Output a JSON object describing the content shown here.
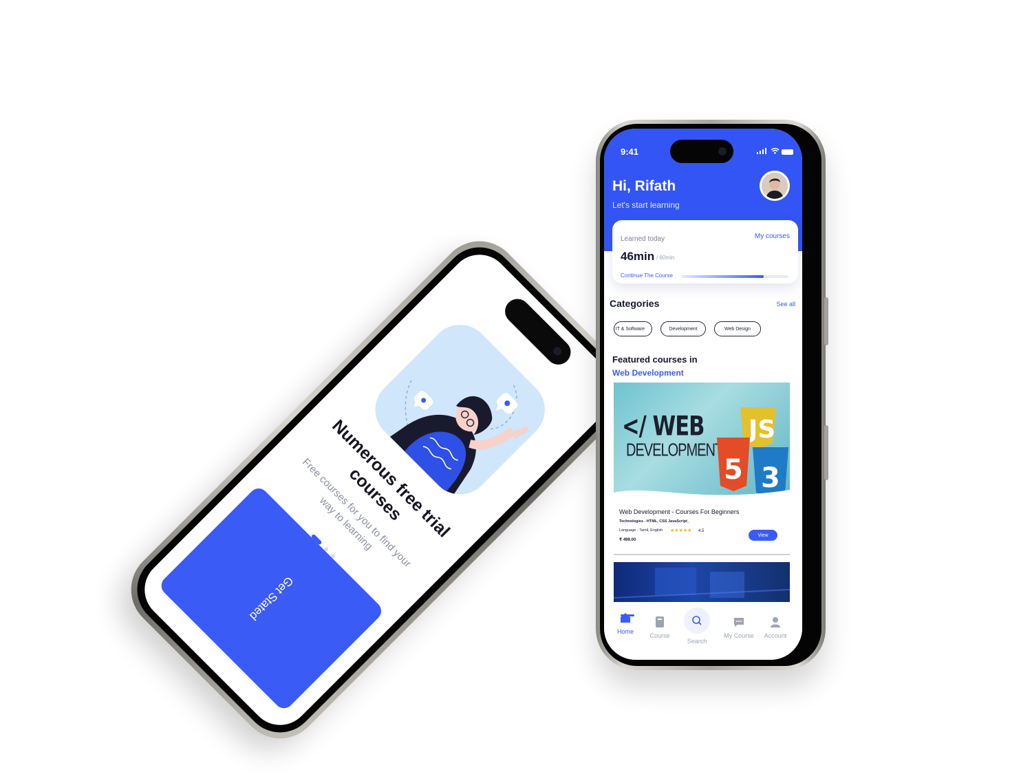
{
  "onboarding": {
    "title": "Numerous free trial courses",
    "subtitle": "Free courses for you to find your way to learning",
    "button_label": "Get Stated",
    "page_count": 3,
    "active_page": 1
  },
  "status_bar": {
    "time": "9:41"
  },
  "header": {
    "greeting": "Hi, Rifath",
    "subtitle": "Let's start learning"
  },
  "learned_today": {
    "label": "Learned today",
    "link": "My courses",
    "value": "46min",
    "of_total": "/ 60min",
    "continue_label": "Continue The Course",
    "progress": 0.77
  },
  "categories": {
    "title": "Categories",
    "see_all": "See all",
    "chips": [
      "IT & Software",
      "Development",
      "Web Design"
    ]
  },
  "featured": {
    "title": "Featured courses in",
    "subtitle": "Web Development"
  },
  "banner": {
    "line1": "</ WEB",
    "line2": "DEVELOPMENT>"
  },
  "course": {
    "title": "Web Development - Courses For Beginners",
    "technologies": "Technologies - HTML, CSS JavaScript_",
    "language": "Language - Tamil, English",
    "stars": "★★★★★",
    "rating": "4.5",
    "price": "₹ 499.00",
    "view_label": "View"
  },
  "tabs": {
    "home": "Home",
    "course": "Course",
    "search": "Search",
    "my_course": "My Course",
    "account": "Account"
  },
  "colors": {
    "accent": "#3b5bf6",
    "header": "#3355f5",
    "illustration_bg": "#cfe6fb",
    "star": "#f5b301"
  },
  "icons": [
    "home-icon",
    "book-icon",
    "search-icon",
    "chat-icon",
    "user-icon",
    "battery-icon",
    "wifi-icon",
    "signal-icon"
  ]
}
